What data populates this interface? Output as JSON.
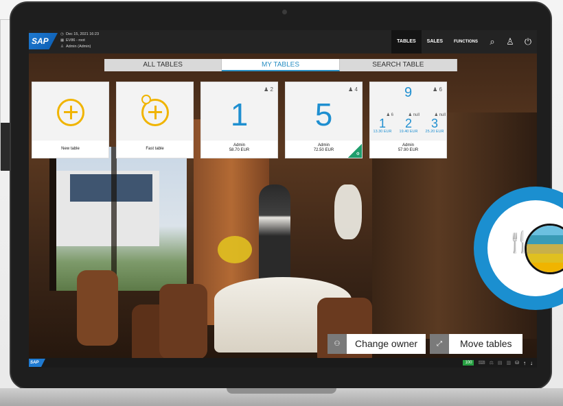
{
  "topbar": {
    "logo": "SAP",
    "datetime": "Dec 15, 2021 16:23",
    "store": "EV86 - root",
    "user": "Admin (Admin)",
    "nav": [
      "TABLES",
      "SALES",
      "FUNCTIONS"
    ],
    "active_nav": "TABLES",
    "icons": [
      "search-icon",
      "user-icon",
      "power-icon"
    ]
  },
  "tabs": [
    {
      "label": "ALL TABLES",
      "active": false
    },
    {
      "label": "MY TABLES",
      "active": true
    },
    {
      "label": "SEARCH TABLE",
      "active": false
    }
  ],
  "tiles": [
    {
      "caption": "New table",
      "icon": "add-icon"
    },
    {
      "caption": "Fast table",
      "icon": "clock-add-icon"
    },
    {
      "number": "1",
      "seats": "2",
      "owner": "Admin",
      "amount": "58.70 EUR"
    },
    {
      "number": "5",
      "seats": "4",
      "owner": "Admin",
      "amount": "72.50 EUR"
    },
    {
      "number": "9",
      "seats": "6",
      "owner": "Admin",
      "amount": "57.90 EUR",
      "sub": [
        {
          "number": "1",
          "seats": "6",
          "amount": "13.30 EUR"
        },
        {
          "number": "2",
          "seats": "null",
          "amount": "19.40 EUR"
        },
        {
          "number": "3",
          "seats": "null",
          "amount": "25.20 EUR"
        }
      ]
    }
  ],
  "actions": {
    "change_owner": "Change owner",
    "move_tables": "Move tables"
  },
  "statusbar": {
    "logo": "SAP",
    "indicator": "100"
  },
  "colors": {
    "accent": "#1f8fd0",
    "add": "#f0b400",
    "topbar": "#232323",
    "status_green": "#27a042"
  }
}
